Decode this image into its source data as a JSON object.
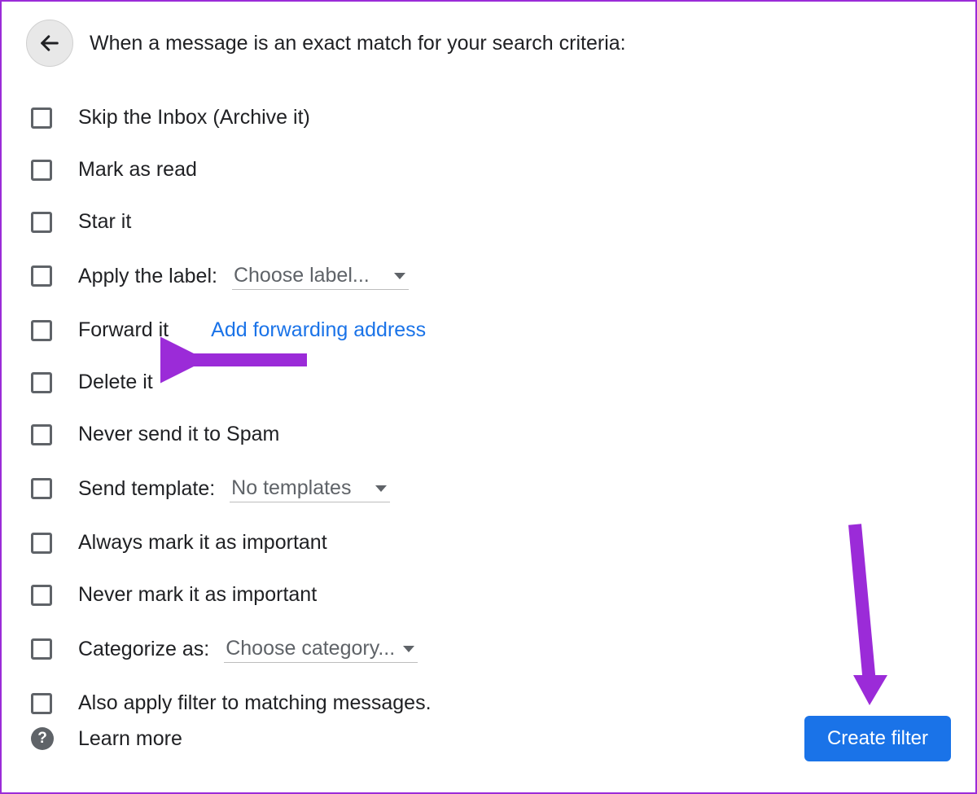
{
  "header": {
    "prompt": "When a message is an exact match for your search criteria:"
  },
  "options": {
    "skip_inbox": "Skip the Inbox (Archive it)",
    "mark_read": "Mark as read",
    "star_it": "Star it",
    "apply_label": "Apply the label:",
    "apply_label_value": "Choose label...",
    "forward_it": "Forward it",
    "forward_link": "Add forwarding address",
    "delete_it": "Delete it",
    "never_spam": "Never send it to Spam",
    "send_template": "Send template:",
    "send_template_value": "No templates",
    "always_important": "Always mark it as important",
    "never_important": "Never mark it as important",
    "categorize": "Categorize as:",
    "categorize_value": "Choose category...",
    "also_apply": "Also apply filter to matching messages."
  },
  "footer": {
    "learn_more": "Learn more",
    "create_filter": "Create filter"
  }
}
